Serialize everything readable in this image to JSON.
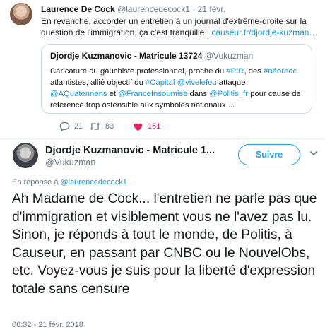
{
  "parent_tweet": {
    "author_name": "Laurence De Cock",
    "author_handle": "@laurencedecock1",
    "separator": "·",
    "date": "21 févr.",
    "text": "En revanche, accorder un entretien à un journal d'extrême-droite sur la question de l'immigration, ça c'est tranquille : ",
    "link": "causeur.fr/djordje-kuzman…",
    "quoted": {
      "author_name": "Djordje Kuzmanovic - Matricule 13724",
      "author_handle": "@Vukuzman",
      "text_before": "Caricature du gauchiste professionnel, proche du ",
      "hashtag_pir": "#PIR",
      "text_mid1": ", des ",
      "hashtag_neoreac": "#néoreac",
      "text_mid2": " atlantistes, allié objectif du ",
      "hashtag_capital": "#Capital",
      "text_mid3": " ",
      "mention_vivelefeu": "@vivelefeu",
      "text_mid4": " attaque ",
      "mention_aquatennens": "@AQuatennens",
      "text_mid5": " et ",
      "mention_fi": "@FranceInsoumise",
      "text_mid6": " dans ",
      "mention_politis": "@Politis_fr",
      "text_after": " pour cause de référence trop ostensible aux symboles nationaux...."
    },
    "actions": {
      "replies": "21",
      "retweets": "83",
      "likes": "151"
    }
  },
  "main_tweet": {
    "author_name": "Djordje Kuzmanovic - Matricule 1...",
    "author_handle": "@Vukuzman",
    "follow_label": "Suivre",
    "reply_prefix": "En réponse à ",
    "reply_handle": "@laurencedecock1",
    "text": "Ah Madame de Cock... l'entretien ne parle pas que d'immigration et visiblement vous ne l'avez pas lu. Sinon, je réponds à tout le monde, de Politis, à Causeur, en passant par CNBC ou le NouvelObs, etc. Voyez-vous je suis pour la liberté d'expression totale sans censure",
    "timestamp": "06:32 - 21 févr. 2018"
  },
  "icons": {
    "reply": "reply-icon",
    "retweet": "retweet-icon",
    "like": "heart-icon",
    "caret": "chevron-down-icon"
  },
  "colors": {
    "link": "#1b95e0",
    "like": "#e0245e",
    "follow": "#1da1f2",
    "muted": "#657786"
  }
}
